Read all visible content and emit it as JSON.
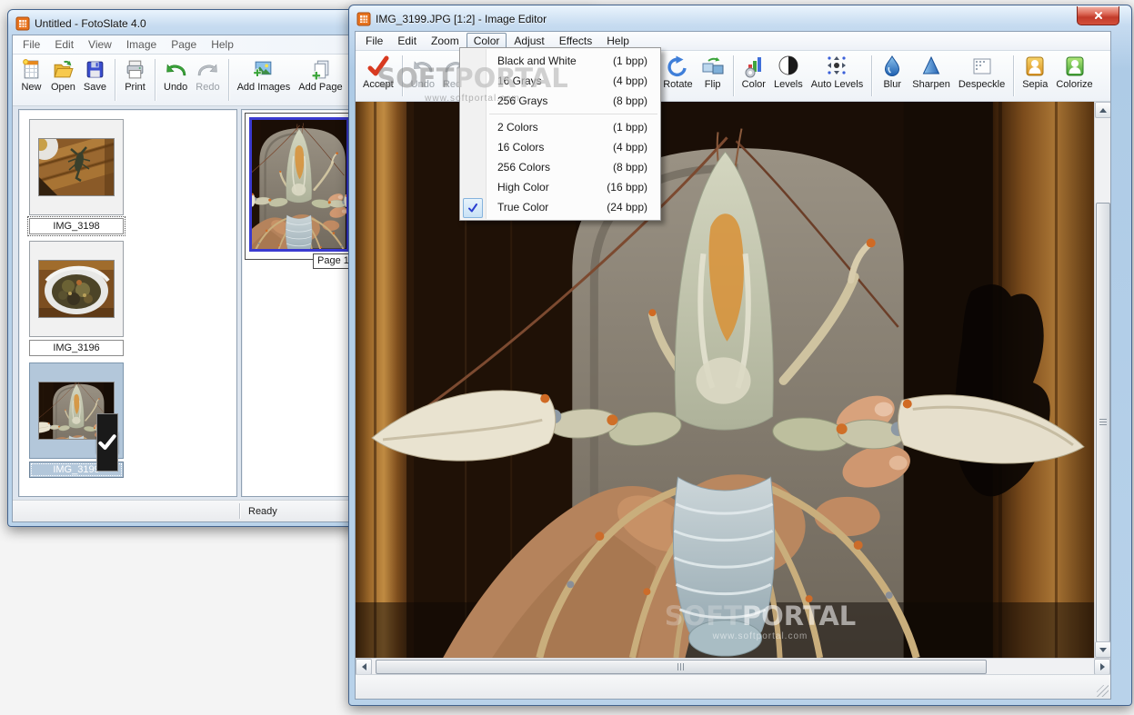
{
  "colors": {
    "close_button_red": "#c23b2a",
    "selection_blue": "#b3c7da",
    "check_badge_orange": "#ef8f1f",
    "menu_check_blue": "#2b3fd0",
    "page_photo_selection": "#3a3ad0"
  },
  "watermark": {
    "soft": "SOFT",
    "portal": "PORTAL",
    "url": "www.softportal.com"
  },
  "fotoslate": {
    "title": "Untitled - FotoSlate 4.0",
    "menu": [
      "File",
      "Edit",
      "View",
      "Image",
      "Page",
      "Help"
    ],
    "toolbar": [
      "New",
      "Open",
      "Save",
      "Print",
      "Undo",
      "Redo",
      "Add Images",
      "Add Page"
    ],
    "thumbnails": [
      {
        "name": "IMG_3198"
      },
      {
        "name": "IMG_3196"
      },
      {
        "name": "IMG_3199"
      }
    ],
    "page_label": "Page 1",
    "status": "Ready"
  },
  "editor": {
    "title": "IMG_3199.JPG [1:2] - Image Editor",
    "menu": [
      "File",
      "Edit",
      "Zoom",
      "Color",
      "Adjust",
      "Effects",
      "Help"
    ],
    "toolbar": [
      "Accept",
      "Undo",
      "Redo",
      "Rotate",
      "Flip",
      "Color",
      "Levels",
      "Auto Levels",
      "Blur",
      "Sharpen",
      "Despeckle",
      "Sepia",
      "Colorize"
    ],
    "color_menu": {
      "items": [
        {
          "label": "Black and White",
          "bpp": "(1 bpp)"
        },
        {
          "label": "16 Grays",
          "bpp": "(4 bpp)"
        },
        {
          "label": "256 Grays",
          "bpp": "(8 bpp)"
        },
        {
          "label": "2 Colors",
          "bpp": "(1 bpp)"
        },
        {
          "label": "16 Colors",
          "bpp": "(4 bpp)"
        },
        {
          "label": "256 Colors",
          "bpp": "(8 bpp)"
        },
        {
          "label": "High Color",
          "bpp": "(16 bpp)"
        },
        {
          "label": "True Color",
          "bpp": "(24 bpp)",
          "checked": true
        }
      ]
    }
  }
}
